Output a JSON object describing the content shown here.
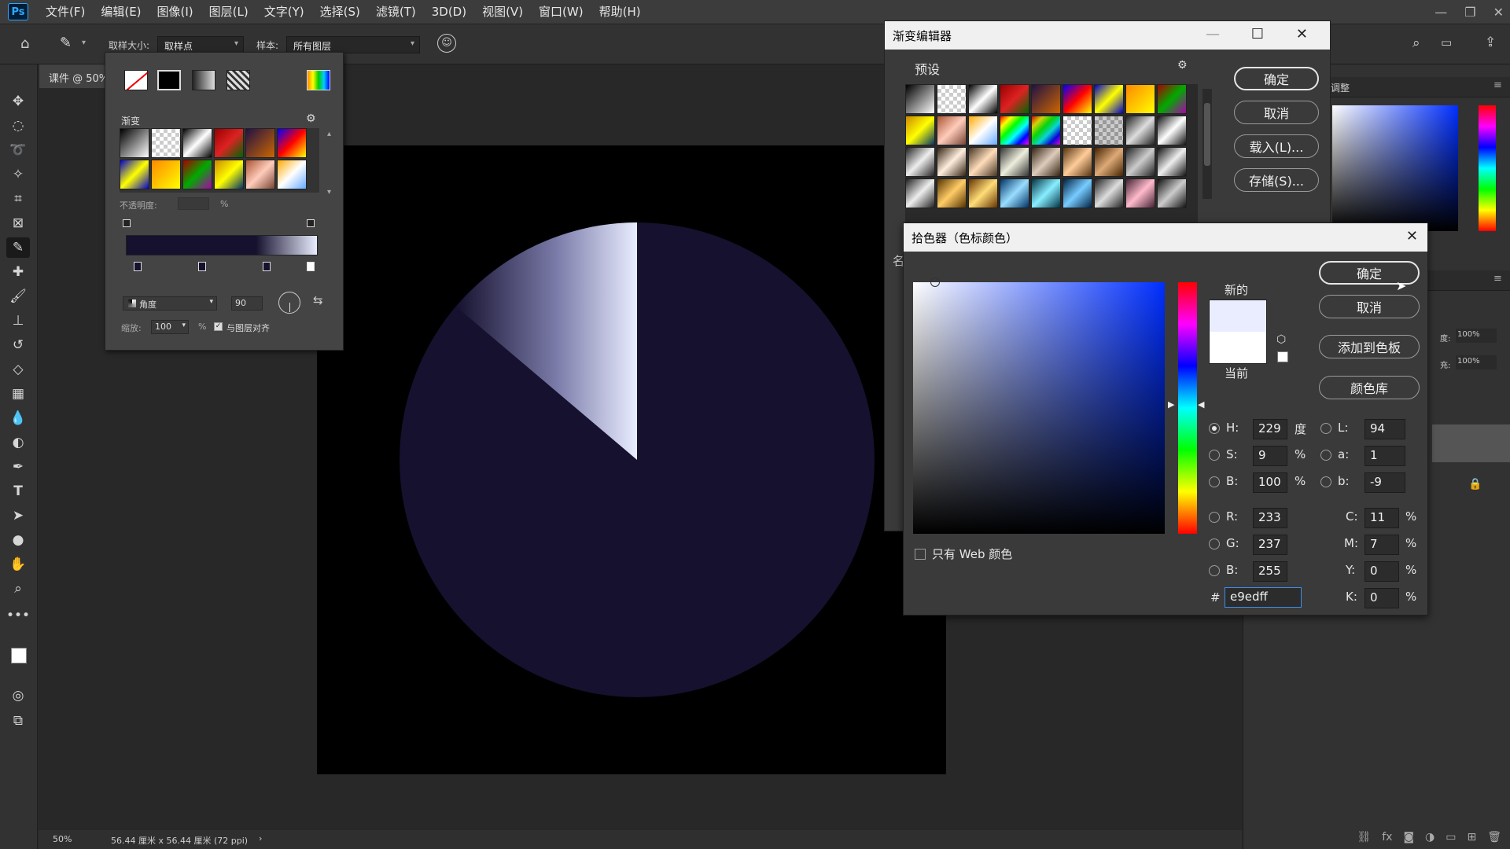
{
  "menubar": {
    "logo": "Ps",
    "items": [
      "文件(F)",
      "编辑(E)",
      "图像(I)",
      "图层(L)",
      "文字(Y)",
      "选择(S)",
      "滤镜(T)",
      "3D(D)",
      "视图(V)",
      "窗口(W)",
      "帮助(H)"
    ]
  },
  "options": {
    "sample_size_label": "取样大小:",
    "sample_size_value": "取样点",
    "sample_label": "样本:",
    "sample_value": "所有图层"
  },
  "document": {
    "tab": "课件 @ 50%",
    "zoom": "50%",
    "info": "56.44 厘米 x 56.44 厘米 (72 ppi)",
    "circle_color": "#15112e"
  },
  "gradient_picker": {
    "section": "渐变",
    "opacity_label": "不透明度:",
    "opacity_unit": "%",
    "style_value": "角度",
    "angle_value": "90",
    "scale_label": "缩放:",
    "scale_value": "100",
    "scale_unit": "%",
    "align_label": "与图层对齐"
  },
  "gradient_editor": {
    "title": "渐变编辑器",
    "presets_label": "预设",
    "ok": "确定",
    "cancel": "取消",
    "load": "载入(L)...",
    "save": "存储(S)...",
    "name_label_partial": "名"
  },
  "color_picker": {
    "title": "拾色器（色标颜色）",
    "new_label": "新的",
    "current_label": "当前",
    "new_color": "#e9edff",
    "current_color": "#ffffff",
    "ok": "确定",
    "cancel": "取消",
    "add_swatch": "添加到色板",
    "color_libraries": "颜色库",
    "web_only": "只有 Web 颜色",
    "H": {
      "label": "H:",
      "value": "229",
      "unit": "度"
    },
    "S": {
      "label": "S:",
      "value": "9",
      "unit": "%"
    },
    "Bv": {
      "label": "B:",
      "value": "100",
      "unit": "%"
    },
    "R": {
      "label": "R:",
      "value": "233"
    },
    "G": {
      "label": "G:",
      "value": "237"
    },
    "Bc": {
      "label": "B:",
      "value": "255"
    },
    "L": {
      "label": "L:",
      "value": "94"
    },
    "a": {
      "label": "a:",
      "value": "1"
    },
    "b": {
      "label": "b:",
      "value": "-9"
    },
    "C": {
      "label": "C:",
      "value": "11",
      "unit": "%"
    },
    "M": {
      "label": "M:",
      "value": "7",
      "unit": "%"
    },
    "Y": {
      "label": "Y:",
      "value": "0",
      "unit": "%"
    },
    "K": {
      "label": "K:",
      "value": "0",
      "unit": "%"
    },
    "hex_label": "#",
    "hex_value": "e9edff"
  },
  "right_panel": {
    "adjust_title": "调整",
    "opacity_label": "度:",
    "opacity_value": "100%",
    "fill_label": "充:",
    "fill_value": "100%"
  }
}
